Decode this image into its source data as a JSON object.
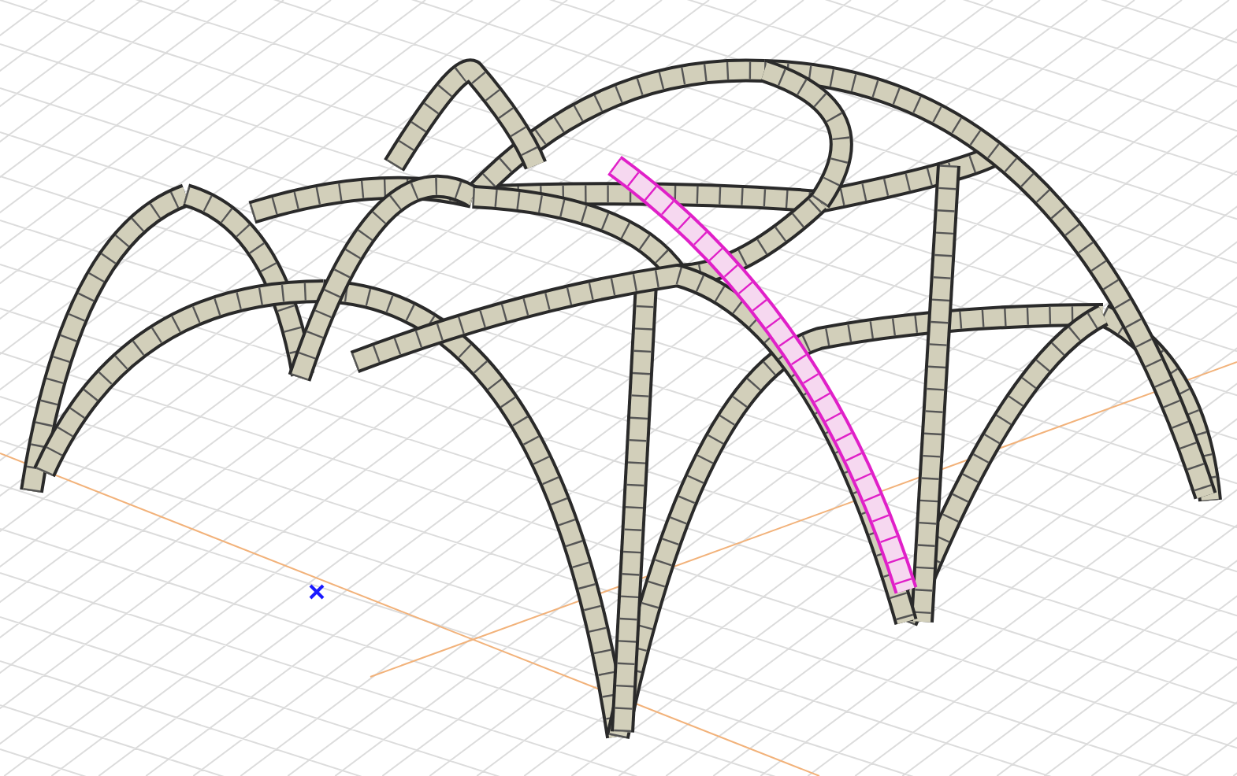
{
  "viewport": {
    "picked_rib": {
      "selected": true
    }
  }
}
